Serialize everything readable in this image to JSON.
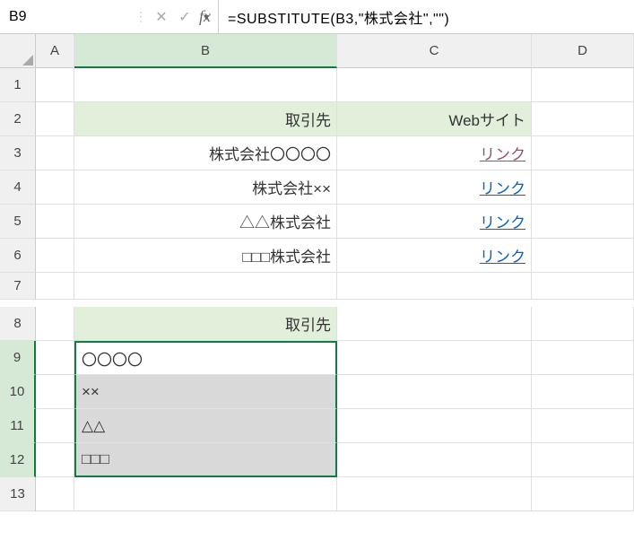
{
  "name_box": "B9",
  "formula": "=SUBSTITUTE(B3,\"株式会社\",\"\")",
  "columns": [
    "A",
    "B",
    "C",
    "D"
  ],
  "rows": [
    "1",
    "2",
    "3",
    "4",
    "5",
    "6",
    "7",
    "8",
    "9",
    "10",
    "11",
    "12",
    "13"
  ],
  "headers": {
    "b2": "取引先",
    "c2": "Webサイト",
    "b8": "取引先"
  },
  "partners": {
    "b3": "株式会社〇〇〇〇",
    "b4": "株式会社××",
    "b5": "△△株式会社",
    "b6": "□□□株式会社"
  },
  "links": {
    "c3": "リンク",
    "c4": "リンク",
    "c5": "リンク",
    "c6": "リンク"
  },
  "results": {
    "b9": "〇〇〇〇",
    "b10": "××",
    "b11": "△△",
    "b12": "□□□"
  }
}
